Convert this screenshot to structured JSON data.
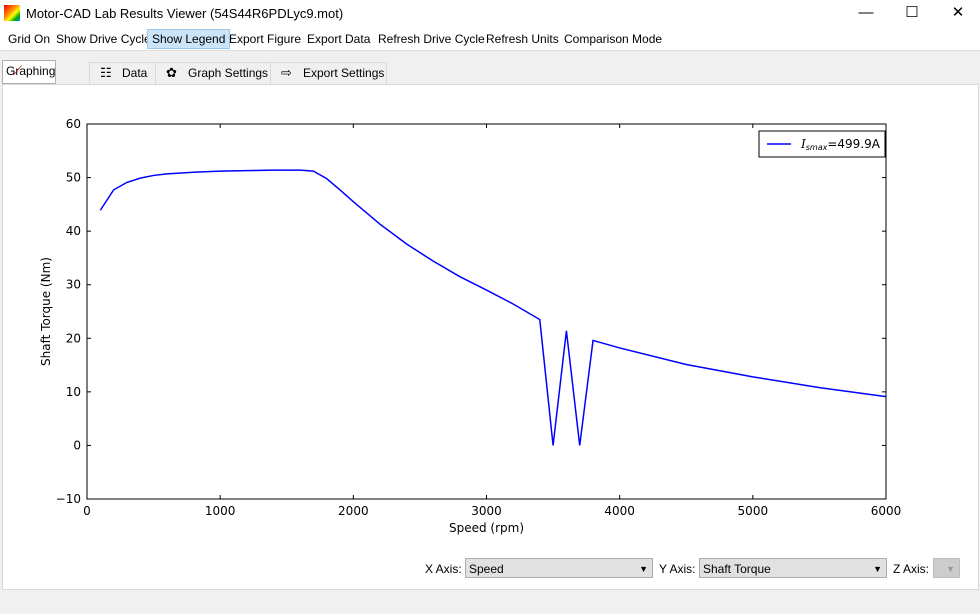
{
  "window": {
    "title": "Motor-CAD Lab Results Viewer (54S44R6PDLyc9.mot)",
    "minimize": "—",
    "maximize": "☐",
    "close": "✕"
  },
  "menu": [
    "Grid On",
    "Show Drive Cycle",
    "Show Legend",
    "Export Figure",
    "Export Data",
    "Refresh Drive Cycle",
    "Refresh Units",
    "Comparison Mode"
  ],
  "tabs": [
    "Graphing",
    "Data",
    "Graph Settings",
    "Export Settings"
  ],
  "axes_controls": {
    "x_label": "X Axis:",
    "x_value": "Speed",
    "y_label": "Y Axis:",
    "y_value": "Shaft Torque",
    "z_label": "Z Axis:"
  },
  "chart_data": {
    "type": "line",
    "xlabel": "Speed  (rpm)",
    "ylabel": "Shaft Torque  (Nm)",
    "xlim": [
      0,
      6000
    ],
    "ylim": [
      -10,
      60
    ],
    "xticks": [
      0,
      1000,
      2000,
      3000,
      4000,
      5000,
      6000
    ],
    "yticks": [
      -10,
      0,
      10,
      20,
      30,
      40,
      50,
      60
    ],
    "legend": {
      "label_italic": "I",
      "label_sub": "smax",
      "label_value": "=499.9A",
      "placement": "top-right"
    },
    "series": [
      {
        "name": "Ismax=499.9A",
        "color": "#0000ff",
        "x": [
          100,
          200,
          300,
          400,
          500,
          600,
          800,
          1000,
          1200,
          1400,
          1600,
          1700,
          1800,
          1900,
          2000,
          2200,
          2400,
          2600,
          2800,
          3000,
          3200,
          3400,
          3500,
          3600,
          3700,
          3800,
          4000,
          4500,
          5000,
          5500,
          6000
        ],
        "y": [
          43.9,
          47.7,
          49.1,
          49.9,
          50.4,
          50.7,
          51.0,
          51.2,
          51.3,
          51.4,
          51.4,
          51.2,
          49.8,
          47.7,
          45.5,
          41.3,
          37.6,
          34.4,
          31.5,
          29.0,
          26.4,
          23.5,
          0,
          21.4,
          0,
          19.6,
          18.2,
          15.1,
          12.8,
          10.8,
          9.1
        ]
      }
    ]
  }
}
